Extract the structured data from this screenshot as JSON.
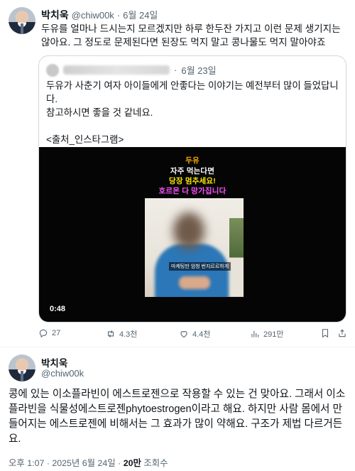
{
  "tweet": {
    "author_name": "박치욱",
    "author_handle": "@chiw00k",
    "separator": "·",
    "date": "6월 24일",
    "text": "두유를 얼마나 드시는지 모르겠지만 하루 한두잔 가지고 이런 문제 생기지는 않아요. 그 정도로 문제된다면 된장도 먹지 말고 콩나물도 먹지 말아야죠",
    "actions": {
      "reply_count": "27",
      "retweet_count": "4.3천",
      "like_count": "4.4천",
      "view_count": "291만"
    }
  },
  "quoted": {
    "separator": "·",
    "date": "6월 23일",
    "text_line1": "두유가 사춘기 여자 아이들에게 안좋다는 이야기는 예전부터 많이 들었답니다.",
    "text_line2": "참고하시면 좋을 것 같네요.",
    "text_line3": "<출처_인스타그램>",
    "video": {
      "overlay_line1": "두유",
      "overlay_line2": "자주 먹는다면",
      "overlay_line3": "당장 멈추세요!",
      "overlay_line4": "호르몬 다 망가집니다",
      "subtitle": "마케팅만 엄청 번지르르하게",
      "duration": "0:48"
    }
  },
  "reply": {
    "author_name": "박치욱",
    "author_handle": "@chiw00k",
    "text": "콩에 있는 이소플라빈이 에스트로젠으로 작용할 수 있는 건 맞아요. 그래서 이소플라빈을 식물성에스트로젠phytoestrogen이라고 해요. 하지만 사람 몸에서 만들어지는 에스트로젠에 비해서는 그 효과가 많이 약해요. 구조가 제법 다르거든요.",
    "timestamp": "오후 1:07 · 2025년 6월 24일 · ",
    "views_count": "20만",
    "views_label": " 조회수"
  },
  "colors": {
    "text": "#0f1419",
    "muted": "#536471",
    "border": "#cfd9de"
  }
}
